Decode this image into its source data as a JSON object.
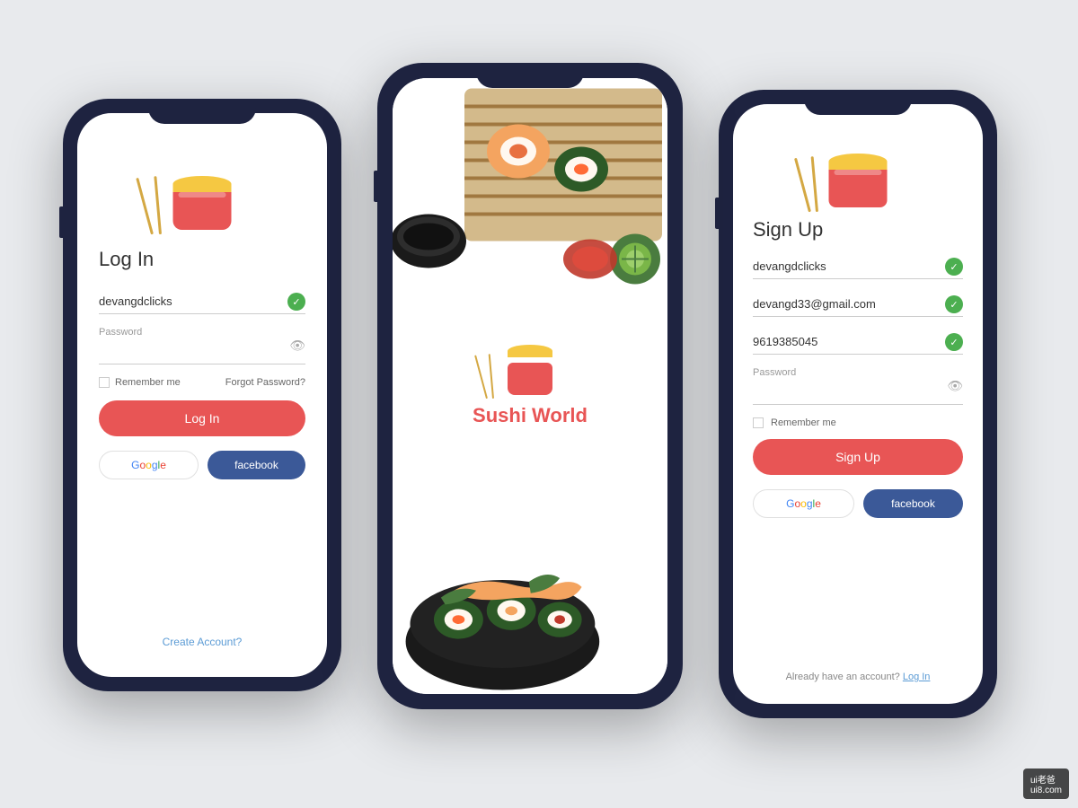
{
  "background": "#e8eaed",
  "phone1": {
    "title": "Log In",
    "username_value": "devangdclicks",
    "password_label": "Password",
    "remember_me": "Remember me",
    "forgot_password": "Forgot Password?",
    "login_button": "Log In",
    "google_label": "Google",
    "facebook_label": "facebook",
    "create_account": "Create Account?"
  },
  "phone2": {
    "app_name_italic": "Sushi",
    "app_name_regular": " World"
  },
  "phone3": {
    "title": "Sign Up",
    "username_value": "devangdclicks",
    "email_value": "devangd33@gmail.com",
    "phone_value": "9619385045",
    "password_label": "Password",
    "remember_me": "Remember me",
    "signup_button": "Sign Up",
    "google_label": "Google",
    "facebook_label": "facebook",
    "already_account": "Already have an account?",
    "login_link": "Log In"
  },
  "watermark": {
    "site": "ui8.com",
    "brand": "ui老爸"
  }
}
